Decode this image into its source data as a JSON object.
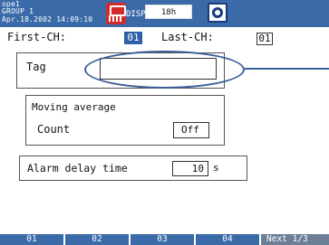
{
  "header": {
    "operator": "ope1",
    "group": "GROUP 1",
    "datetime": "Apr.18.2002 14:09:10",
    "disp_label": "DISP",
    "time_div": "18h",
    "colors": {
      "bar": "#3a6aa8",
      "alarm_icon": "#d42a2a"
    }
  },
  "channels": {
    "first_label": "First-CH:",
    "first_value": "01",
    "last_label": "Last-CH:",
    "last_value": "01"
  },
  "tag": {
    "label": "Tag",
    "value": ""
  },
  "moving_average": {
    "title": "Moving average",
    "count_label": "Count",
    "count_value": "Off"
  },
  "alarm_delay": {
    "label": "Alarm delay time",
    "value": "10",
    "unit": "s"
  },
  "softkeys": [
    "01",
    "02",
    "03",
    "04",
    "Next 1/3"
  ]
}
